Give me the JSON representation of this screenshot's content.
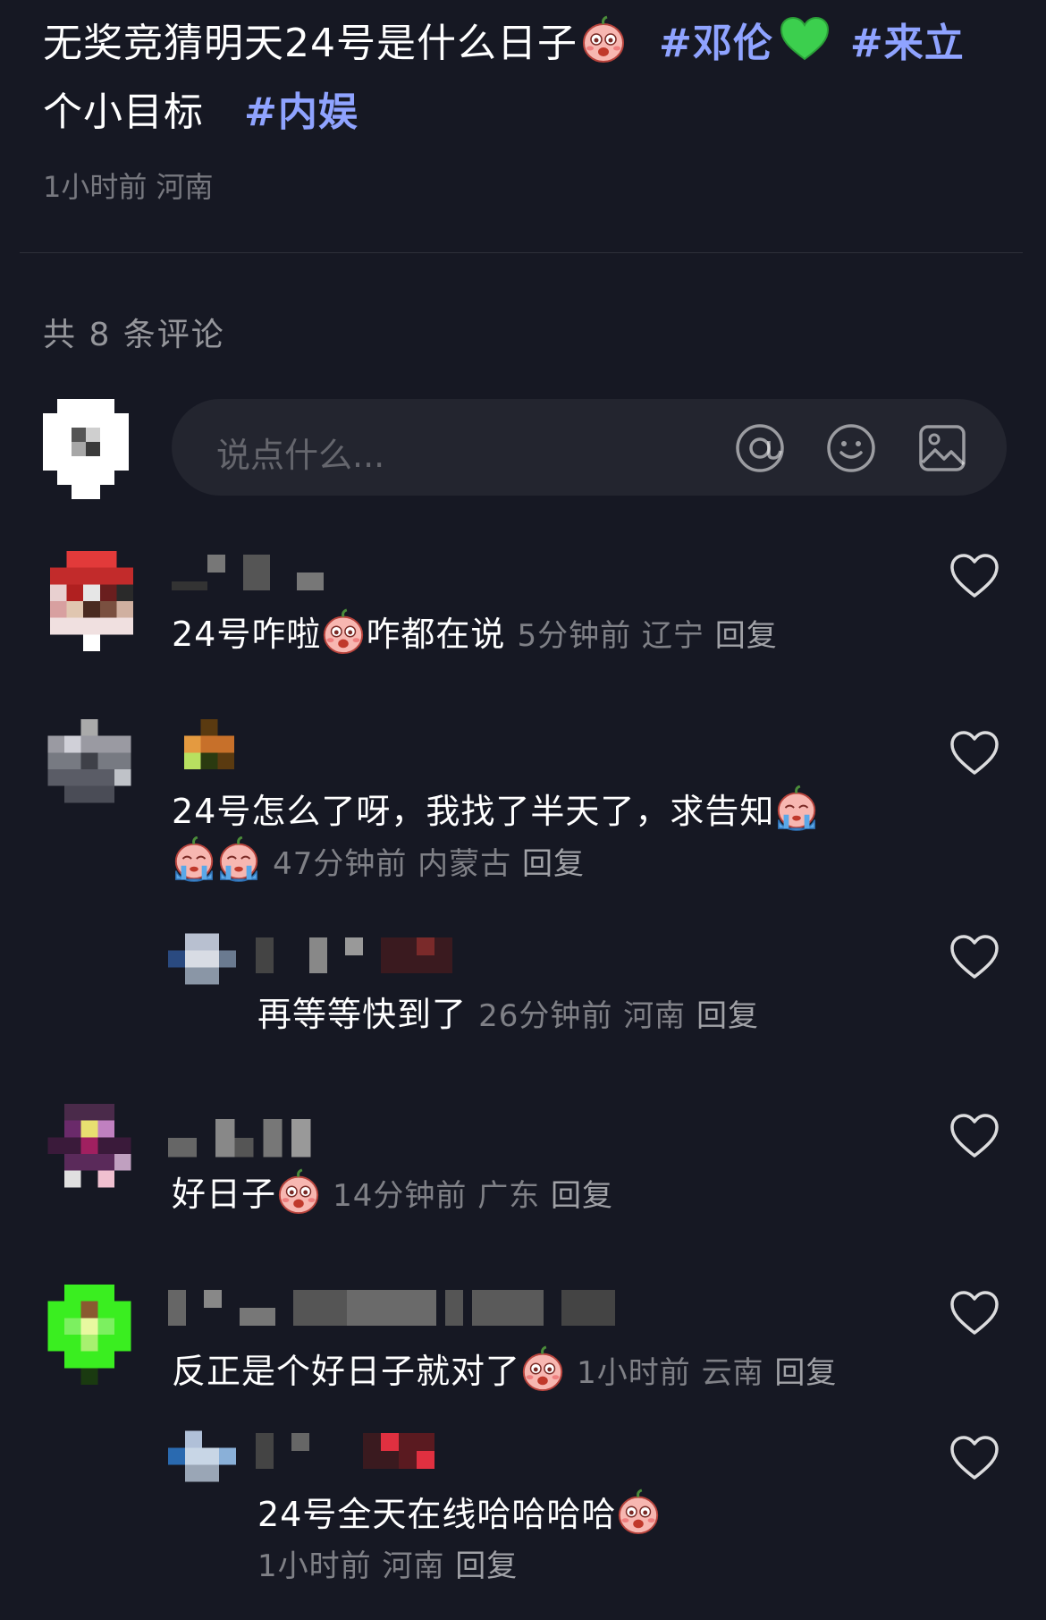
{
  "post": {
    "text_part1": "无奖竞猜明天24号是什么日子",
    "hashtag1": "#邓伦",
    "hashtag2": "#来立个小目标",
    "hashtag2_line1": "#来立",
    "hashtag2_line2": "个小目标",
    "hashtag3": "#内娱",
    "meta": "1小时前 河南"
  },
  "comment_count": "共 8 条评论",
  "input": {
    "placeholder": "说点什么..."
  },
  "icons": {
    "mention": "at-icon",
    "emoji": "smiley-icon",
    "image": "image-icon",
    "like": "heart-outline-icon"
  },
  "colors": {
    "background": "#161823",
    "hashtag": "#8fa3ff",
    "meta": "rgba(255,255,255,0.45)"
  },
  "comments": [
    {
      "text_a": "24号咋啦",
      "text_b": "咋都在说",
      "time": "5分钟前",
      "location": "辽宁",
      "reply": "回复"
    },
    {
      "text_line1": "24号怎么了呀，我找了半天了，求告知",
      "time": "47分钟前",
      "location": "内蒙古",
      "reply": "回复"
    },
    {
      "text": "再等等快到了",
      "time": "26分钟前",
      "location": "河南",
      "reply": "回复"
    },
    {
      "text": "好日子",
      "time": "14分钟前",
      "location": "广东",
      "reply": "回复"
    },
    {
      "text": "反正是个好日子就对了",
      "time": "1小时前",
      "location": "云南",
      "reply": "回复"
    },
    {
      "text": "24号全天在线哈哈哈哈",
      "time": "1小时前",
      "location": "河南",
      "reply": "回复"
    }
  ]
}
